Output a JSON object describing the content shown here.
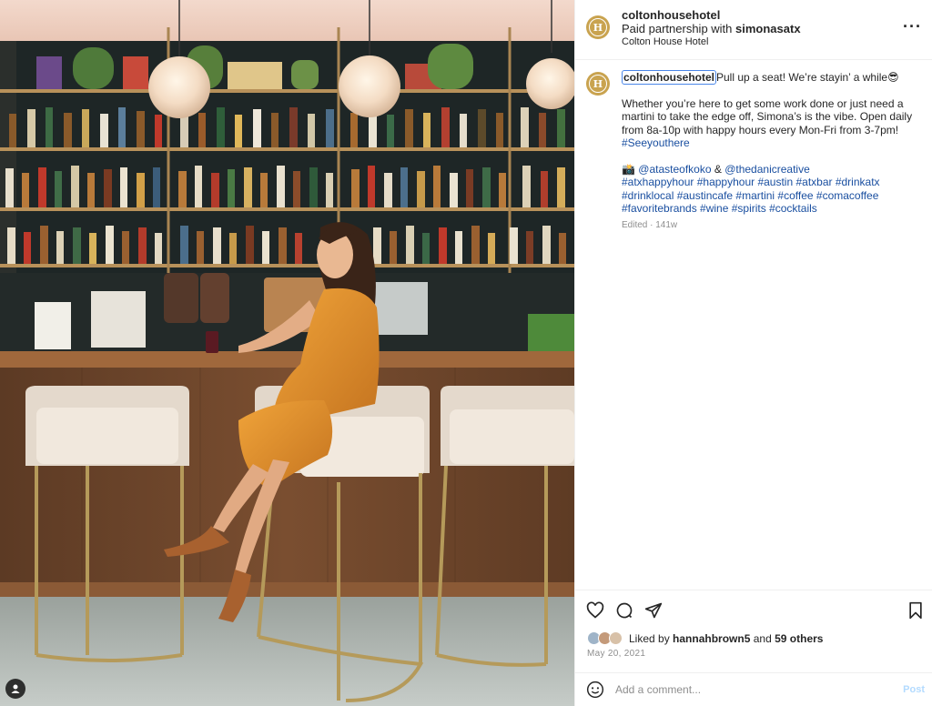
{
  "post": {
    "username": "coltonhousehotel",
    "avatar_letter": "H",
    "partnership_prefix": "Paid partnership with ",
    "partner": "simonasatx",
    "location": "Colton House Hotel",
    "more_icon": "more-horizontal-icon"
  },
  "caption": {
    "username": "coltonhousehotel",
    "first_line": "Pull up a seat! We’re stayin’ a while😎",
    "body_lines": [
      "Whether you’re here to get some work done or just need a",
      "martini to take the edge off, Simona’s is the vibe. Open daily",
      "from 8a-10p with happy hours every Mon-Fri from 3-7pm!"
    ],
    "tag_line_1": "#Seeyouthere",
    "credit_camera": "📸 ",
    "credit_1": "@atasteofkoko",
    "credit_join": " & ",
    "credit_2": "@thedanicreative",
    "hashtags_1": "#atxhappyhour #happyhour #austin #atxbar #drinkatx",
    "hashtags_2": "#drinklocal #austincafe #martini #coffee #comacoffee",
    "hashtags_3": "#favoritebrands #wine #spirits #cocktails",
    "meta": "Edited · 141w"
  },
  "actions": {
    "icons": [
      "heart-icon",
      "comment-icon",
      "share-icon",
      "bookmark-icon"
    ],
    "liked_by_prefix": "Liked by ",
    "liked_by_user": "hannahbrown5",
    "liked_by_mid": " and ",
    "liked_by_others": "59 others",
    "date": "May 20, 2021",
    "comment_placeholder": "Add a comment...",
    "post_label": "Post"
  },
  "colors": {
    "avatar": "#c9a34f",
    "link": "#1a4fa0",
    "post_disabled": "#b3dbff",
    "dress": "#d98a2b"
  }
}
